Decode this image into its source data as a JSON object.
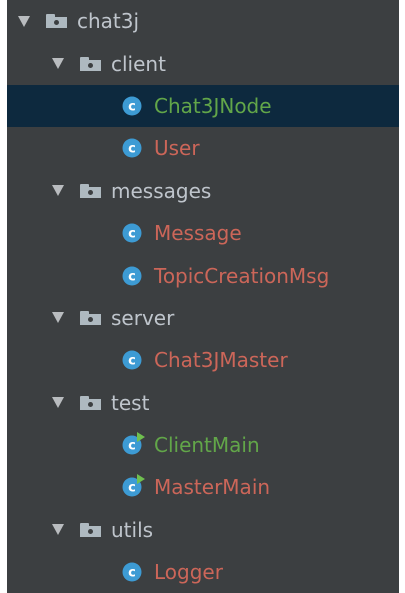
{
  "tree": {
    "root": {
      "name": "chat3j",
      "icon": "folder-icon"
    },
    "folders": [
      {
        "name": "client",
        "icon": "folder-icon",
        "files": [
          {
            "name": "Chat3JNode",
            "icon": "class-icon",
            "status": "added",
            "color": "#62a649",
            "selected": true
          },
          {
            "name": "User",
            "icon": "class-icon",
            "status": "modified",
            "color": "#cc6659",
            "selected": false
          }
        ]
      },
      {
        "name": "messages",
        "icon": "folder-icon",
        "files": [
          {
            "name": "Message",
            "icon": "class-icon",
            "status": "modified",
            "color": "#cc6659",
            "selected": false
          },
          {
            "name": "TopicCreationMsg",
            "icon": "class-icon",
            "status": "modified",
            "color": "#cc6659",
            "selected": false
          }
        ]
      },
      {
        "name": "server",
        "icon": "folder-icon",
        "files": [
          {
            "name": "Chat3JMaster",
            "icon": "class-icon",
            "status": "modified",
            "color": "#cc6659",
            "selected": false
          }
        ]
      },
      {
        "name": "test",
        "icon": "folder-icon",
        "files": [
          {
            "name": "ClientMain",
            "icon": "runnable-class-icon",
            "status": "added",
            "color": "#62a649",
            "selected": false
          },
          {
            "name": "MasterMain",
            "icon": "runnable-class-icon",
            "status": "modified",
            "color": "#cc6659",
            "selected": false
          }
        ]
      },
      {
        "name": "utils",
        "icon": "folder-icon",
        "files": [
          {
            "name": "Logger",
            "icon": "class-icon",
            "status": "modified",
            "color": "#cc6659",
            "selected": false
          }
        ]
      }
    ]
  },
  "colors": {
    "background": "#3c3f41",
    "selection": "#0d293e",
    "folder_label": "#bfc5cc",
    "added": "#62a649",
    "modified": "#cc6659",
    "class_icon": "#3d9bd4"
  }
}
